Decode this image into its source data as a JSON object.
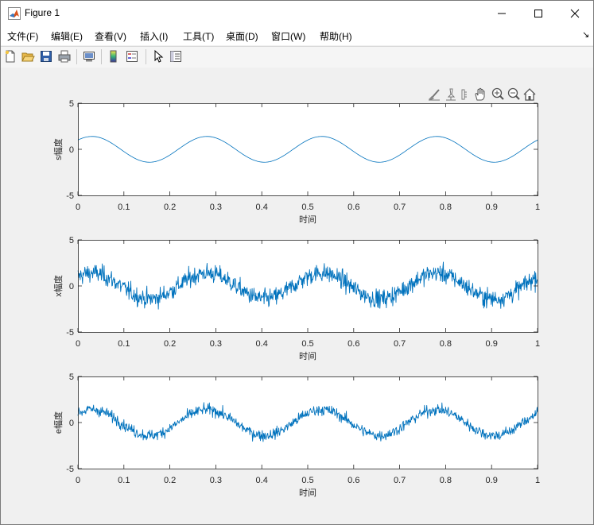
{
  "window": {
    "title": "Figure 1",
    "menu": [
      "文件(F)",
      "编辑(E)",
      "查看(V)",
      "插入(I)",
      "工具(T)",
      "桌面(D)",
      "窗口(W)",
      "帮助(H)"
    ],
    "menu_overflow_arrow": "↘",
    "controls": [
      "minimize-icon",
      "maximize-icon",
      "close-icon"
    ]
  },
  "toolbar": {
    "buttons": [
      "new-figure-icon",
      "open-file-icon",
      "save-icon",
      "print-icon",
      "link-plot-icon",
      "insert-colorbar-icon",
      "insert-legend-icon",
      "edit-plot-icon",
      "property-inspector-icon"
    ]
  },
  "axes_toolbar": {
    "buttons": [
      "brush-icon",
      "data-tips-icon",
      "pan-icon",
      "zoom-in-icon",
      "zoom-out-icon",
      "restore-view-icon"
    ]
  },
  "chart_data": [
    {
      "type": "line",
      "ylabel": "s幅度",
      "xlabel": "时间",
      "xlim": [
        0,
        1
      ],
      "ylim": [
        -5,
        5
      ],
      "xticks": [
        "0",
        "0.1",
        "0.2",
        "0.3",
        "0.4",
        "0.5",
        "0.6",
        "0.7",
        "0.8",
        "0.9",
        "1"
      ],
      "yticks": [
        "5",
        "0",
        "-5"
      ],
      "signal": {
        "amplitude": 1.4,
        "frequency_hz": 4,
        "phase_rad": 0.8,
        "noise_std": 0
      },
      "color": "#0072BD",
      "grid": false
    },
    {
      "type": "line",
      "ylabel": "x幅度",
      "xlabel": "时间",
      "xlim": [
        0,
        1
      ],
      "ylim": [
        -5,
        5
      ],
      "xticks": [
        "0",
        "0.1",
        "0.2",
        "0.3",
        "0.4",
        "0.5",
        "0.6",
        "0.7",
        "0.8",
        "0.9",
        "1"
      ],
      "yticks": [
        "5",
        "0",
        "-5"
      ],
      "signal": {
        "amplitude": 1.4,
        "frequency_hz": 4,
        "phase_rad": 0.8,
        "noise_std": 0.5
      },
      "color": "#0072BD",
      "grid": false
    },
    {
      "type": "line",
      "ylabel": "e幅度",
      "xlabel": "时间",
      "xlim": [
        0,
        1
      ],
      "ylim": [
        -5,
        5
      ],
      "xticks": [
        "0",
        "0.1",
        "0.2",
        "0.3",
        "0.4",
        "0.5",
        "0.6",
        "0.7",
        "0.8",
        "0.9",
        "1"
      ],
      "yticks": [
        "5",
        "0",
        "-5"
      ],
      "signal": {
        "amplitude": 1.4,
        "frequency_hz": 4,
        "phase_rad": 0.8,
        "noise_std": 0.3
      },
      "color": "#0072BD",
      "grid": false
    }
  ]
}
